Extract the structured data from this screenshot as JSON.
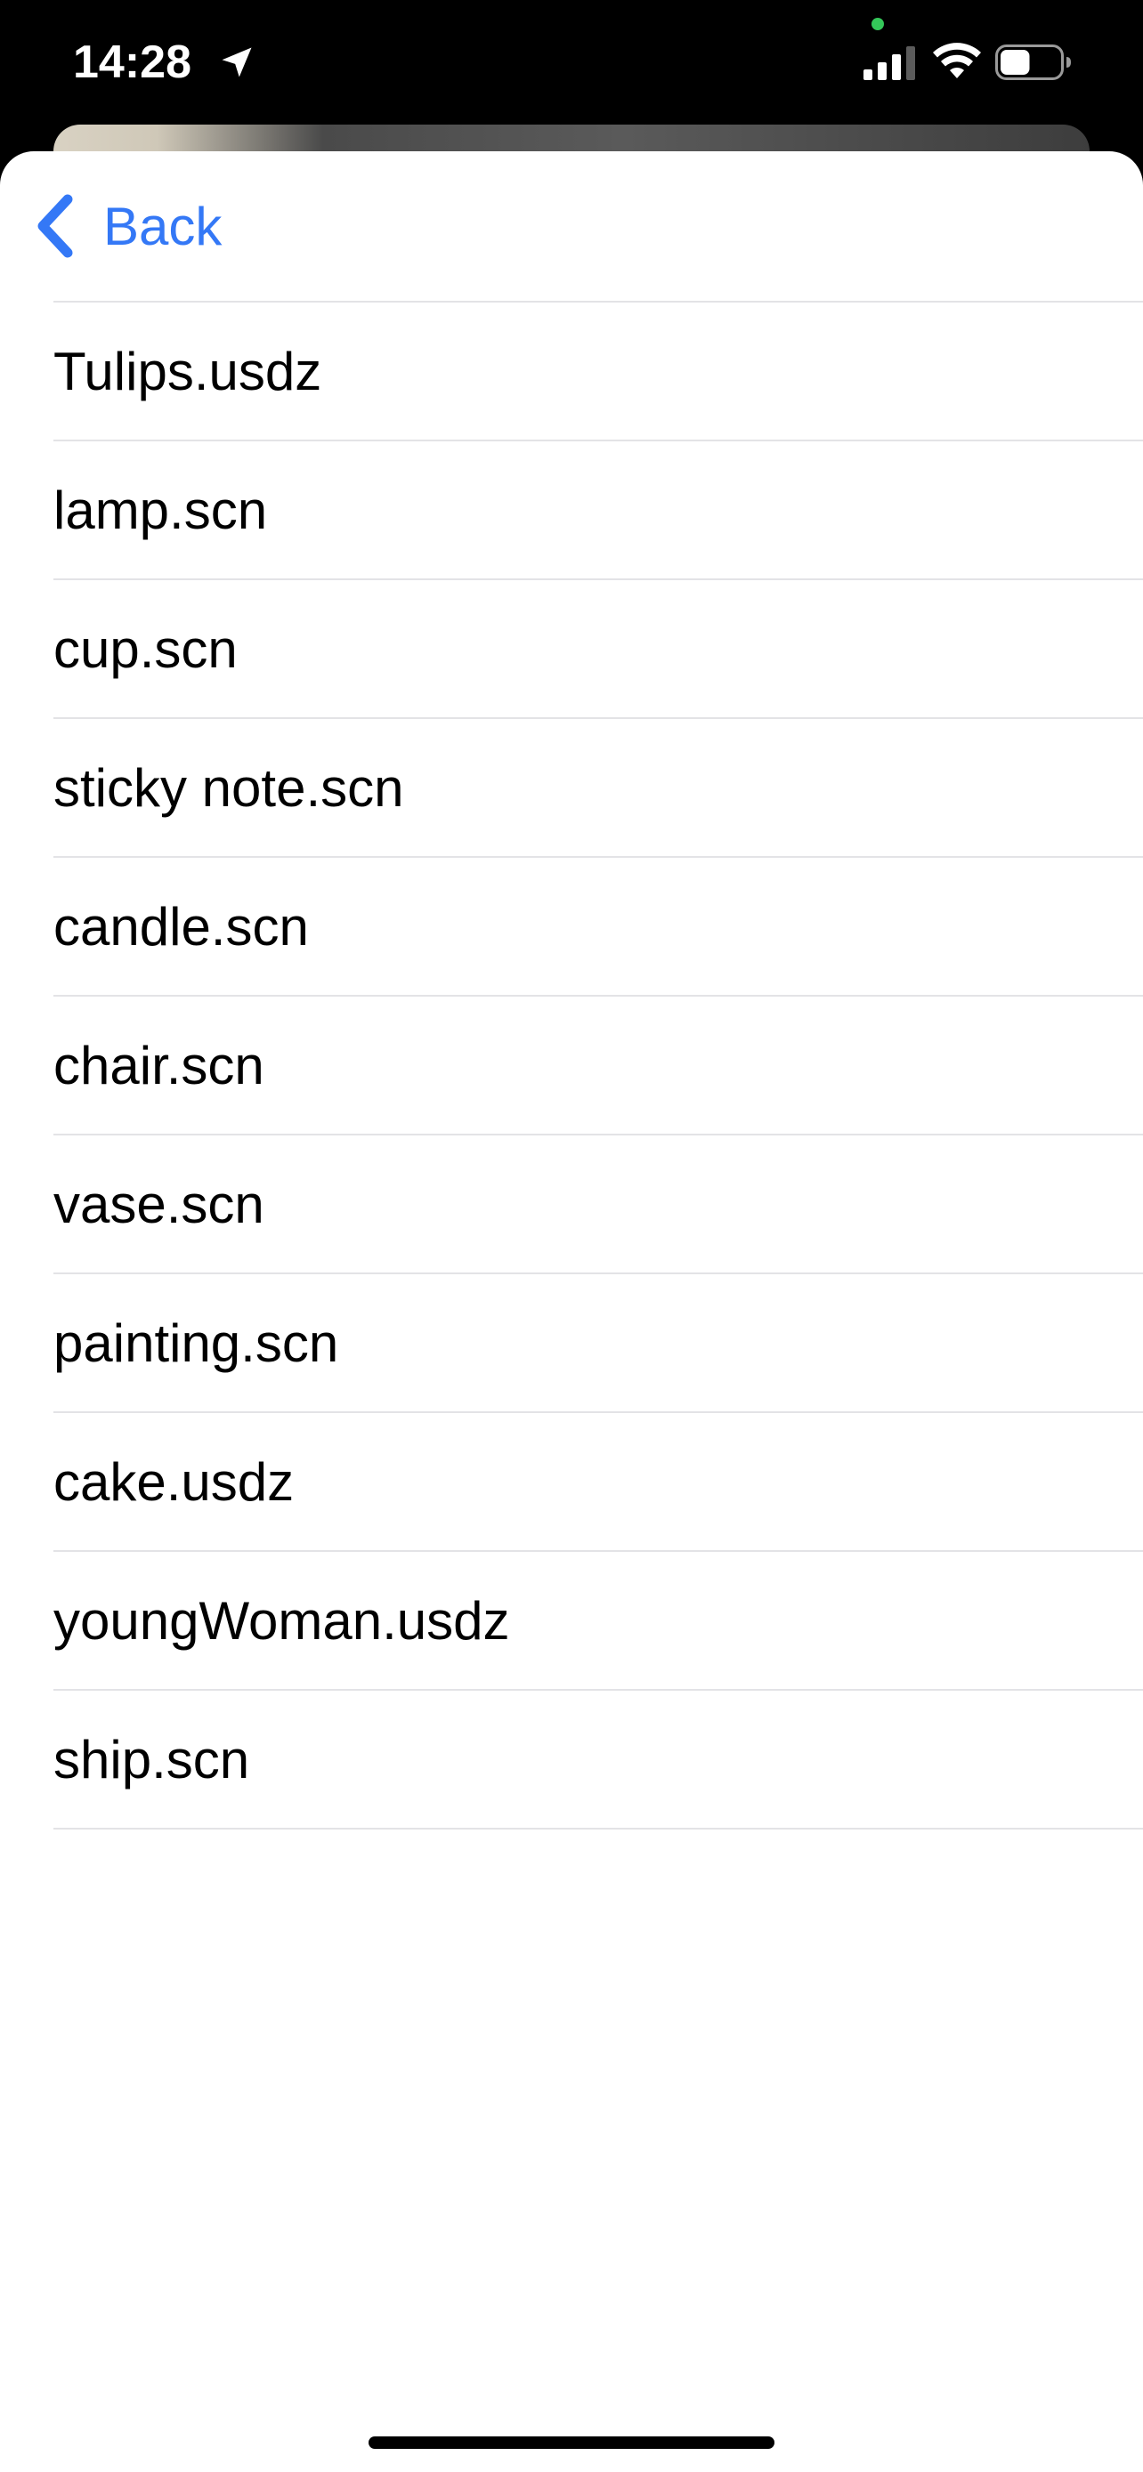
{
  "status_bar": {
    "time": "14:28",
    "icons": [
      "location-arrow-icon",
      "signal-bars-icon",
      "wifi-icon",
      "battery-icon"
    ],
    "mic_indicator_color": "#34c759",
    "signal_bars_active": 3,
    "battery_level": 0.5
  },
  "nav": {
    "back_label": "Back",
    "accent_color": "#3478f6"
  },
  "files": [
    {
      "name": "Tulips.usdz"
    },
    {
      "name": "lamp.scn"
    },
    {
      "name": "cup.scn"
    },
    {
      "name": "sticky note.scn"
    },
    {
      "name": "candle.scn"
    },
    {
      "name": "chair.scn"
    },
    {
      "name": "vase.scn"
    },
    {
      "name": "painting.scn"
    },
    {
      "name": "cake.usdz"
    },
    {
      "name": "youngWoman.usdz"
    },
    {
      "name": "ship.scn"
    }
  ]
}
